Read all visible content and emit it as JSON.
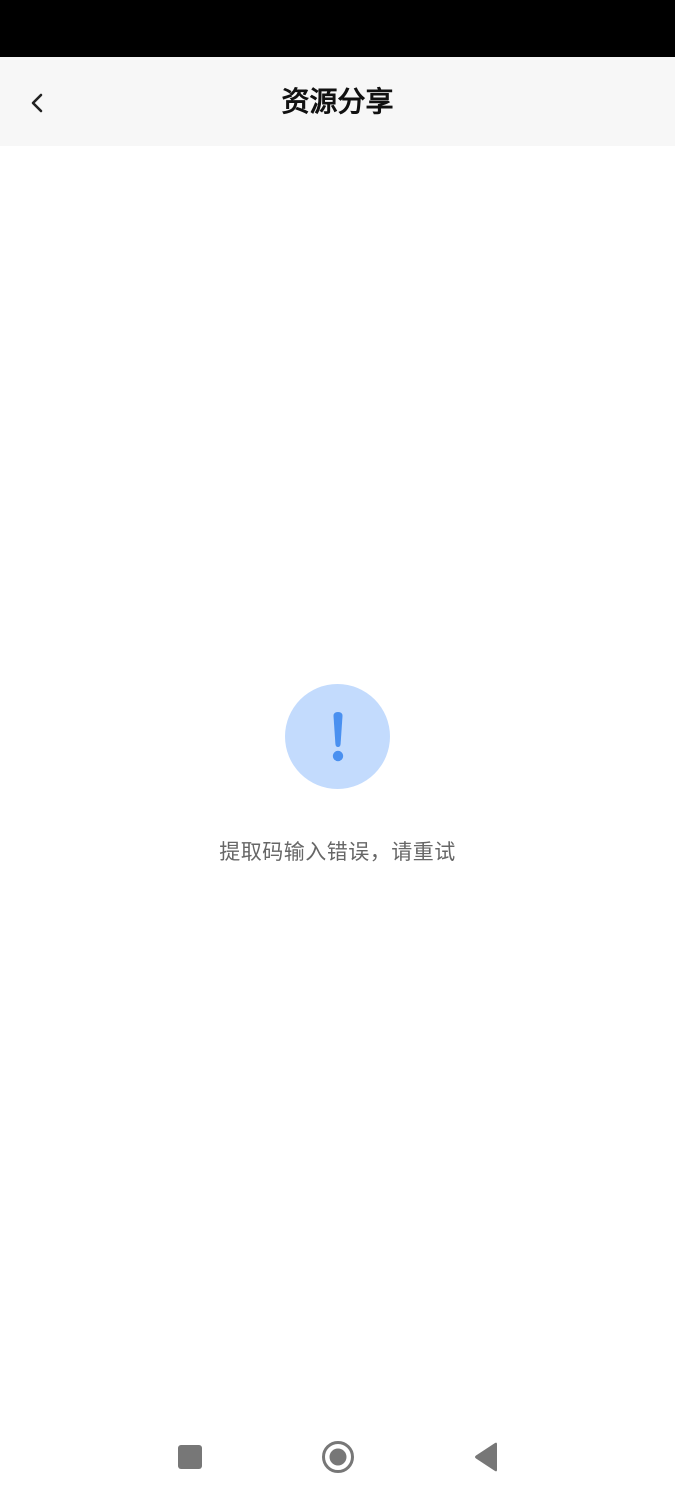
{
  "header": {
    "title": "资源分享"
  },
  "error": {
    "message": "提取码输入错误，请重试"
  },
  "icons": {
    "back": "chevron-left-icon",
    "error": "exclamation-icon",
    "nav_recent": "square-icon",
    "nav_home": "circle-icon",
    "nav_back": "triangle-left-icon"
  },
  "colors": {
    "status_bar": "#000000",
    "header_bg": "#f7f7f7",
    "title": "#111111",
    "icon_circle": "#c3dbfd",
    "icon_mark": "#4a90f0",
    "message": "#666666",
    "nav_icons": "#777777"
  }
}
